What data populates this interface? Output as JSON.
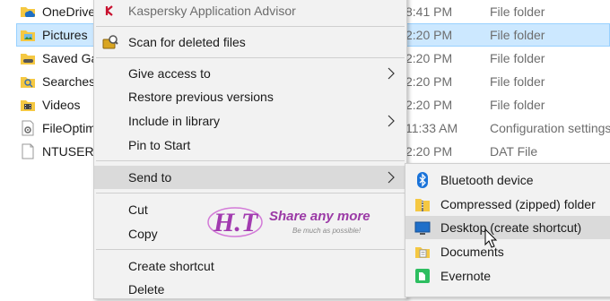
{
  "explorer": {
    "files": [
      {
        "name": "OneDrive",
        "date": "8:41 PM",
        "type": "File folder",
        "icon": "onedrive-folder-icon",
        "selected": false
      },
      {
        "name": "Pictures",
        "date": "2:20 PM",
        "type": "File folder",
        "icon": "pictures-folder-icon",
        "selected": true
      },
      {
        "name": "Saved Games",
        "date": "2:20 PM",
        "type": "File folder",
        "icon": "saved-games-folder-icon",
        "selected": false
      },
      {
        "name": "Searches",
        "date": "2:20 PM",
        "type": "File folder",
        "icon": "searches-folder-icon",
        "selected": false
      },
      {
        "name": "Videos",
        "date": "2:20 PM",
        "type": "File folder",
        "icon": "videos-folder-icon",
        "selected": false
      },
      {
        "name": "FileOptimizer",
        "date": "11:33 AM",
        "type": "Configuration settings",
        "icon": "config-file-icon",
        "selected": false
      },
      {
        "name": "NTUSER.DAT",
        "date": "2:20 PM",
        "type": "DAT File",
        "icon": "blank-file-icon",
        "selected": false
      }
    ]
  },
  "context_menu": {
    "kaspersky": "Kaspersky Application Advisor",
    "scan_deleted": "Scan for deleted files",
    "give_access": "Give access to",
    "restore_versions": "Restore previous versions",
    "include_library": "Include in library",
    "pin_start": "Pin to Start",
    "send_to": "Send to",
    "cut": "Cut",
    "copy": "Copy",
    "create_shortcut": "Create shortcut",
    "delete": "Delete"
  },
  "send_to_menu": {
    "bluetooth": "Bluetooth device",
    "compressed": "Compressed (zipped) folder",
    "desktop": "Desktop (create shortcut)",
    "documents": "Documents",
    "evernote": "Evernote"
  },
  "watermark": {
    "logo_text": "H.T",
    "tagline": "Share any more",
    "slogan": "Be much as possible!"
  },
  "colors": {
    "selection": "#cce8ff",
    "menu_bg": "#f2f2f2",
    "menu_hover": "#dadada",
    "kaspersky_red": "#c8102e",
    "bluetooth_blue": "#1a73d9",
    "evernote_green": "#2dbe60"
  }
}
